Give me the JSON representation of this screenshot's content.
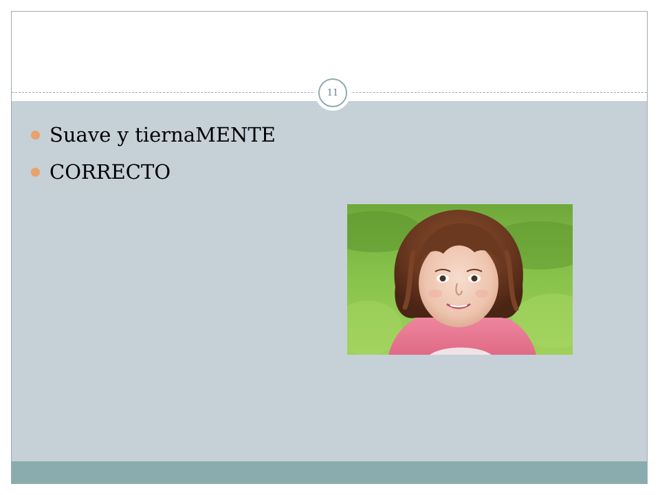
{
  "slide": {
    "page_number": "11",
    "bullets": [
      {
        "text": "Suave y tiernaMENTE"
      },
      {
        "text": "CORRECTO"
      }
    ],
    "photo": {
      "subject": "girl-portrait",
      "alt": "Niña sonriendo sobre el césped"
    },
    "colors": {
      "content_background": "#c5d0d7",
      "footer_bar": "#8aacae",
      "bullet": "#e8a26a",
      "badge_ring": "#8aacae"
    }
  }
}
